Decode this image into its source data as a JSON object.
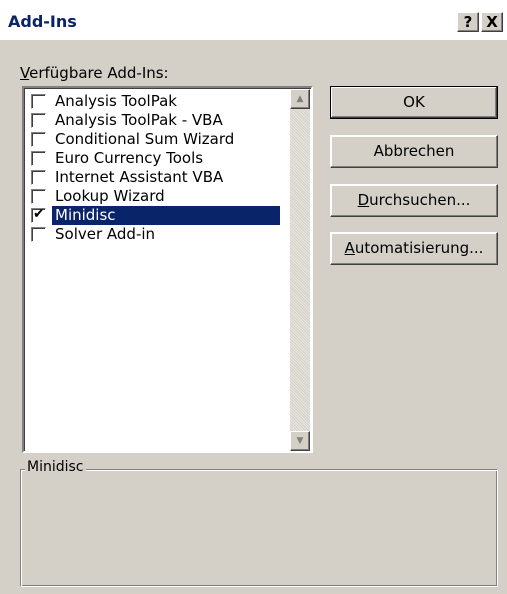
{
  "window": {
    "title": "Add-Ins",
    "help_button": "?",
    "close_button": "X"
  },
  "list": {
    "label_accel": "V",
    "label_rest": "erfügbare Add-Ins:",
    "items": [
      {
        "label": "Analysis ToolPak",
        "checked": false,
        "selected": false
      },
      {
        "label": "Analysis ToolPak - VBA",
        "checked": false,
        "selected": false
      },
      {
        "label": "Conditional Sum Wizard",
        "checked": false,
        "selected": false
      },
      {
        "label": "Euro Currency Tools",
        "checked": false,
        "selected": false
      },
      {
        "label": "Internet Assistant VBA",
        "checked": false,
        "selected": false
      },
      {
        "label": "Lookup Wizard",
        "checked": false,
        "selected": false
      },
      {
        "label": "Minidisc",
        "checked": true,
        "selected": true
      },
      {
        "label": "Solver Add-in",
        "checked": false,
        "selected": false
      }
    ],
    "checkmark": "✔"
  },
  "buttons": {
    "ok": "OK",
    "cancel": "Abbrechen",
    "browse_accel": "D",
    "browse_rest": "urchsuchen...",
    "automation_accel": "A",
    "automation_rest": "utomatisierung..."
  },
  "description": {
    "title": "Minidisc",
    "text": ""
  }
}
